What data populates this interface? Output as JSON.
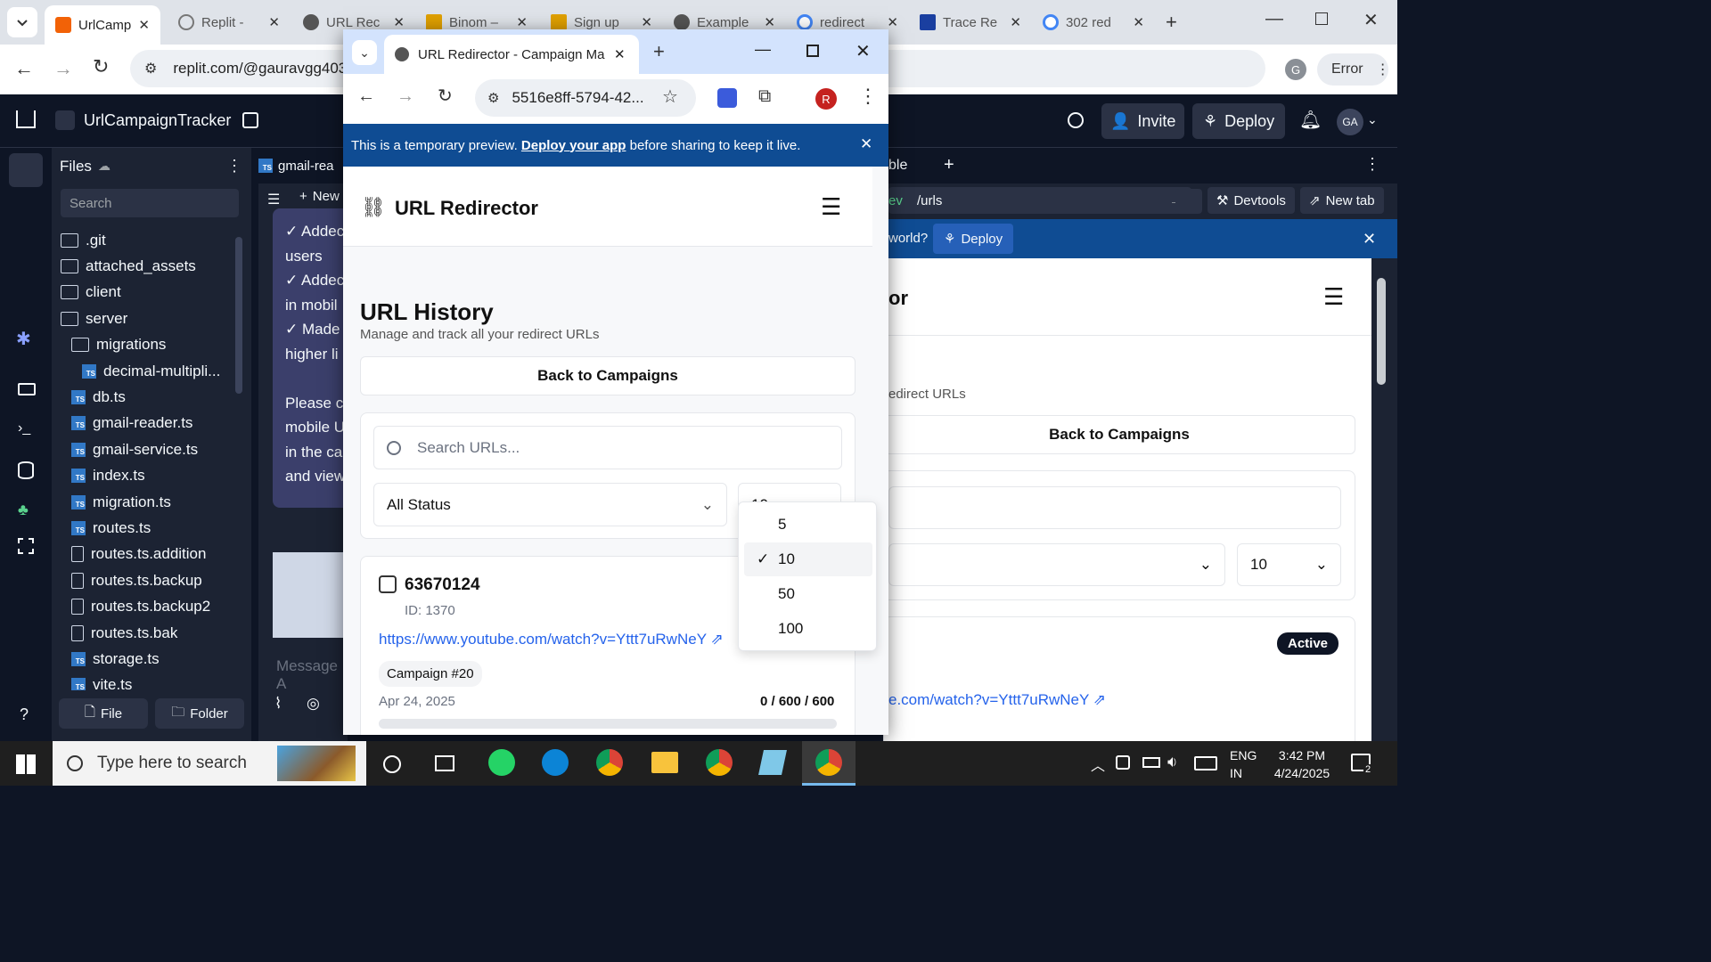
{
  "bg_browser": {
    "tabs": [
      "UrlCamp",
      "Replit -",
      "URL Rec",
      "Binom –",
      "Sign up",
      "Example",
      "redirect",
      "Trace Re",
      "302 red"
    ],
    "url": "replit.com/@gauravgg403",
    "error_label": "Error",
    "profile_initial": "G"
  },
  "replit": {
    "project": "UrlCampaignTracker",
    "invite": "Invite",
    "deploy": "Deploy",
    "avatar": "GA",
    "files_title": "Files",
    "search_placeholder": "Search",
    "tree": [
      {
        "name": ".git",
        "type": "folder",
        "indent": 0
      },
      {
        "name": "attached_assets",
        "type": "folder",
        "indent": 0
      },
      {
        "name": "client",
        "type": "folder",
        "indent": 0
      },
      {
        "name": "server",
        "type": "folder",
        "indent": 0
      },
      {
        "name": "migrations",
        "type": "folder",
        "indent": 1
      },
      {
        "name": "decimal-multipli...",
        "type": "ts",
        "indent": 2
      },
      {
        "name": "db.ts",
        "type": "ts",
        "indent": 1
      },
      {
        "name": "gmail-reader.ts",
        "type": "ts",
        "indent": 1
      },
      {
        "name": "gmail-service.ts",
        "type": "ts",
        "indent": 1
      },
      {
        "name": "index.ts",
        "type": "ts",
        "indent": 1
      },
      {
        "name": "migration.ts",
        "type": "ts",
        "indent": 1
      },
      {
        "name": "routes.ts",
        "type": "ts",
        "indent": 1
      },
      {
        "name": "routes.ts.addition",
        "type": "file",
        "indent": 1
      },
      {
        "name": "routes.ts.backup",
        "type": "file",
        "indent": 1
      },
      {
        "name": "routes.ts.backup2",
        "type": "file",
        "indent": 1
      },
      {
        "name": "routes.ts.bak",
        "type": "file",
        "indent": 1
      },
      {
        "name": "storage.ts",
        "type": "ts",
        "indent": 1
      },
      {
        "name": "vite.ts",
        "type": "ts",
        "indent": 1
      }
    ],
    "file_btn": "File",
    "folder_btn": "Folder",
    "editor_tab": "gmail-rea",
    "new_btn": "New",
    "chat_lines": [
      "✓ Addec",
      "users",
      "✓ Addec",
      "in mobil",
      "✓ Made",
      "higher li",
      "",
      "Please c",
      "mobile U",
      "in the ca",
      "and view"
    ],
    "message_placeholder": "Message A",
    "right_tab": "ble",
    "path": "/urls",
    "dev_label": "ev",
    "devtools": "Devtools",
    "newtab": "New tab",
    "world_text": "world?",
    "deploy_small": "Deploy",
    "preview_title": "or",
    "preview_subtitle": "edirect URLs",
    "preview_back": "Back to Campaigns",
    "preview_per_page": "10",
    "preview_status": "Active",
    "preview_link": "e.com/watch?v=Yttt7uRwNeY"
  },
  "popup": {
    "tab_title": "URL Redirector - Campaign Mar",
    "url": "5516e8ff-5794-42...",
    "profile_initial": "R",
    "banner_text": "This is a temporary preview.",
    "banner_link": "Deploy your app",
    "banner_text2": "before sharing to keep it live.",
    "app_title": "URL Redirector",
    "page_title": "URL History",
    "page_subtitle": "Manage and track all your redirect URLs",
    "back_btn": "Back to Campaigns",
    "search_placeholder": "Search URLs...",
    "status_select": "All Status",
    "per_page_select": "10",
    "dropdown_options": [
      "5",
      "10",
      "50",
      "100"
    ],
    "dropdown_selected": "10",
    "item": {
      "name": "63670124",
      "id": "ID: 1370",
      "url": "https://www.youtube.com/watch?v=Yttt7uRwNeY",
      "campaign": "Campaign #20",
      "date": "Apr 24, 2025",
      "clicks": "0 / 600 / 600",
      "progress": 0
    }
  },
  "taskbar": {
    "search_placeholder": "Type here to search",
    "lang1": "ENG",
    "lang2": "IN",
    "time": "3:42 PM",
    "date": "4/24/2025",
    "notif": "2"
  }
}
